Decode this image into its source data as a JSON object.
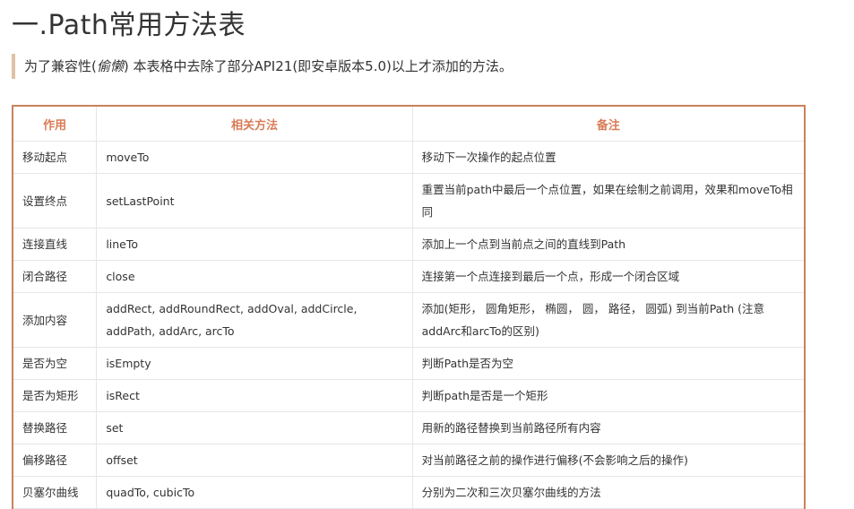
{
  "heading": "一.Path常用方法表",
  "note": {
    "before": "为了兼容性(",
    "italic": "偷懒",
    "after": ") 本表格中去除了部分API21(即安卓版本5.0)以上才添加的方法。"
  },
  "table": {
    "headers": [
      "作用",
      "相关方法",
      "备注"
    ],
    "rows": [
      {
        "action": "移动起点",
        "method": "moveTo",
        "remark": "移动下一次操作的起点位置"
      },
      {
        "action": "设置终点",
        "method": "setLastPoint",
        "remark": "重置当前path中最后一个点位置，如果在绘制之前调用，效果和moveTo相同"
      },
      {
        "action": "连接直线",
        "method": "lineTo",
        "remark": "添加上一个点到当前点之间的直线到Path"
      },
      {
        "action": "闭合路径",
        "method": "close",
        "remark": "连接第一个点连接到最后一个点，形成一个闭合区域"
      },
      {
        "action": "添加内容",
        "method": "addRect, addRoundRect, addOval, addCircle, addPath, addArc, arcTo",
        "remark": "添加(矩形， 圆角矩形， 椭圆， 圆， 路径， 圆弧) 到当前Path (注意addArc和arcTo的区别)"
      },
      {
        "action": "是否为空",
        "method": "isEmpty",
        "remark": "判断Path是否为空"
      },
      {
        "action": "是否为矩形",
        "method": "isRect",
        "remark": "判断path是否是一个矩形"
      },
      {
        "action": "替换路径",
        "method": "set",
        "remark": "用新的路径替换到当前路径所有内容"
      },
      {
        "action": "偏移路径",
        "method": "offset",
        "remark": "对当前路径之前的操作进行偏移(不会影响之后的操作)"
      },
      {
        "action": "贝塞尔曲线",
        "method": "quadTo, cubicTo",
        "remark": "分别为二次和三次贝塞尔曲线的方法"
      }
    ]
  }
}
